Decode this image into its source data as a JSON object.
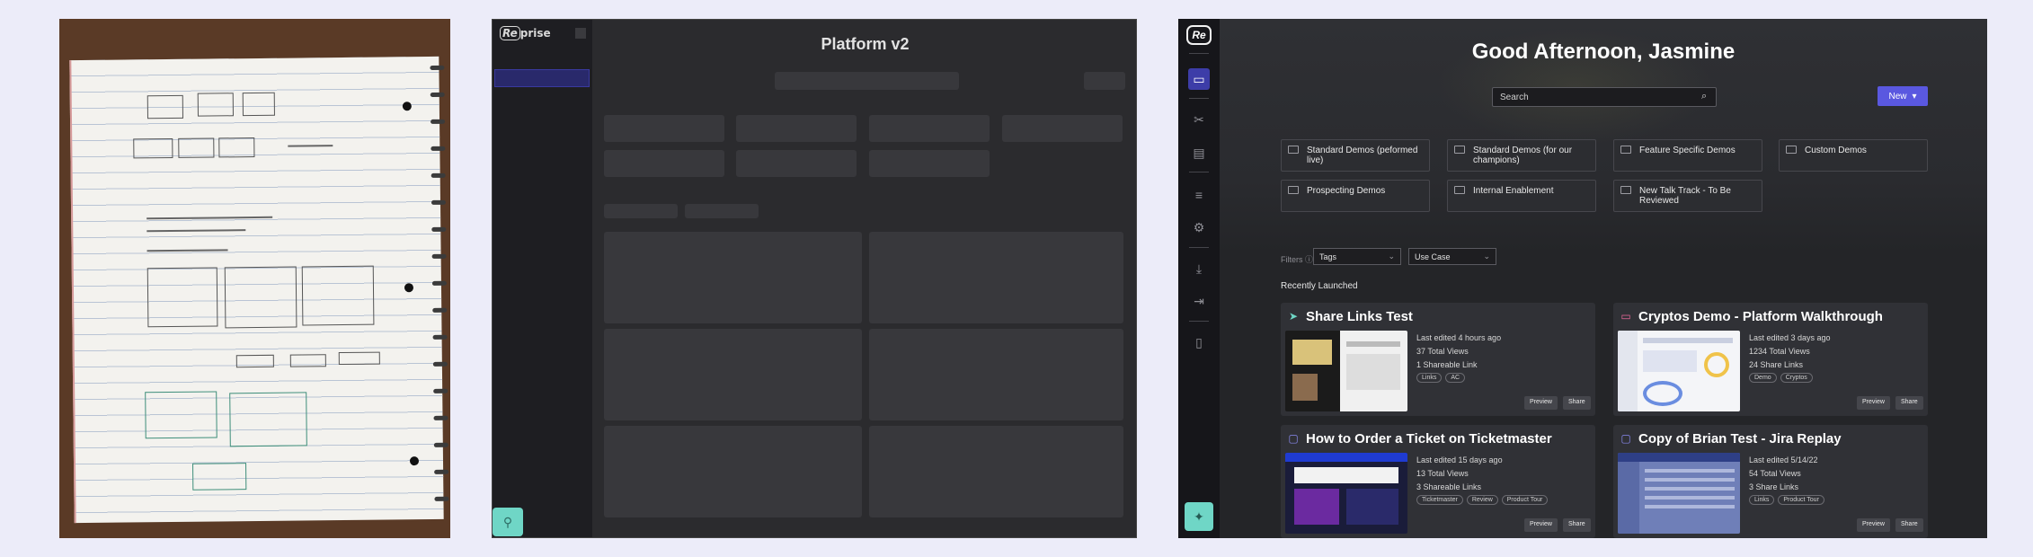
{
  "skeleton": {
    "logo_prefix": "Re",
    "logo_suffix": "prise",
    "title": "Platform v2"
  },
  "app": {
    "logo": "Re",
    "greeting": "Good Afternoon, Jasmine",
    "search_placeholder": "Search",
    "new_button": "New",
    "sidebar_icons": [
      "folder-icon",
      "tools-icon",
      "archive-icon",
      "analytics-icon",
      "settings-icon",
      "download-icon",
      "logout-icon",
      "book-icon"
    ],
    "folders": [
      "Standard Demos (peformed live)",
      "Standard Demos (for our champions)",
      "Feature Specific Demos",
      "Custom Demos",
      "Prospecting Demos",
      "Internal Enablement",
      "New Talk Track - To Be Reviewed"
    ],
    "filters_label": "Filters ⓘ",
    "filter_tags": "Tags",
    "filter_usecase": "Use Case",
    "recent_label": "Recently Launched",
    "preview_label": "Preview",
    "share_label": "Share",
    "cards": [
      {
        "title": "Share Links Test",
        "icon": "send-icon",
        "edited": "Last edited 4 hours ago",
        "views": "37 Total Views",
        "links": "1 Shareable Link",
        "tags": [
          "Links",
          "AC"
        ]
      },
      {
        "title": "Cryptos Demo - Platform Walkthrough",
        "icon": "window-icon",
        "edited": "Last edited 3 days ago",
        "views": "1234 Total Views",
        "links": "24 Share Links",
        "tags": [
          "Demo",
          "Cryptos"
        ]
      },
      {
        "title": "How to Order a Ticket on Ticketmaster",
        "icon": "chat-icon",
        "edited": "Last edited 15 days ago",
        "views": "13 Total Views",
        "links": "3 Shareable Links",
        "tags": [
          "Ticketmaster",
          "Review",
          "Product Tour"
        ]
      },
      {
        "title": "Copy of Brian Test - Jira Replay",
        "icon": "chat-icon",
        "edited": "Last edited 5/14/22",
        "views": "54 Total Views",
        "links": "3 Share Links",
        "tags": [
          "Links",
          "Product Tour"
        ]
      }
    ]
  },
  "colors": {
    "accent": "#5a58e0",
    "teal": "#6fd6c6",
    "background": "#ececf9",
    "dark_panel": "#222325"
  }
}
